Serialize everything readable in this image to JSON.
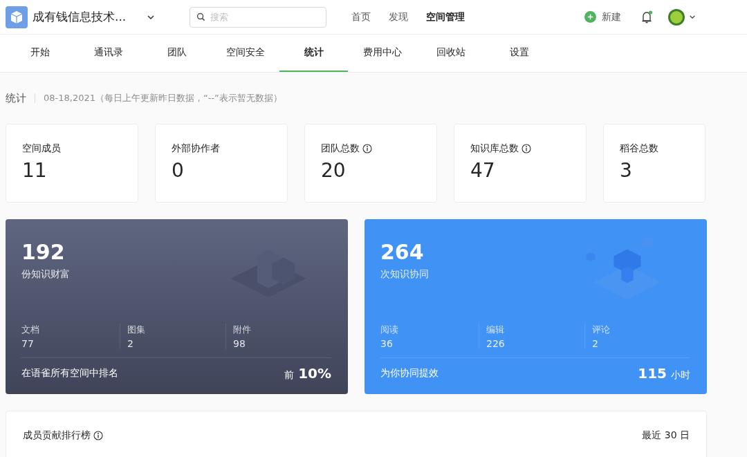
{
  "header": {
    "space_name": "成有钱信息技术...",
    "search": {
      "placeholder": "搜索"
    },
    "nav": [
      {
        "label": "首页",
        "selected": false
      },
      {
        "label": "发现",
        "selected": false
      },
      {
        "label": "空间管理",
        "selected": true
      }
    ],
    "new_button": "新建",
    "notifications": {
      "unread": true
    }
  },
  "tabs": [
    {
      "label": "开始",
      "selected": false
    },
    {
      "label": "通讯录",
      "selected": false
    },
    {
      "label": "团队",
      "selected": false
    },
    {
      "label": "空间安全",
      "selected": false
    },
    {
      "label": "统计",
      "selected": true
    },
    {
      "label": "费用中心",
      "selected": false
    },
    {
      "label": "回收站",
      "selected": false
    },
    {
      "label": "设置",
      "selected": false
    }
  ],
  "page": {
    "title": "统计",
    "subtitle": "08-18,2021（每日上午更新昨日数据，“--”表示暂无数据）"
  },
  "stat_cards": [
    {
      "label": "空间成员",
      "value": "11",
      "info": false
    },
    {
      "label": "外部协作者",
      "value": "0",
      "info": false
    },
    {
      "label": "团队总数",
      "value": "20",
      "info": true
    },
    {
      "label": "知识库总数",
      "value": "47",
      "info": true
    },
    {
      "label": "稻谷总数",
      "value": "3",
      "info": false
    }
  ],
  "summary_cards": [
    {
      "kind": "dark",
      "value": "192",
      "caption": "份知识财富",
      "metrics": [
        {
          "label": "文档",
          "value": "77"
        },
        {
          "label": "图集",
          "value": "2"
        },
        {
          "label": "附件",
          "value": "98"
        }
      ],
      "footer": {
        "label": "在语雀所有空间中排名",
        "prefix": "前",
        "value": "10%"
      }
    },
    {
      "kind": "blue",
      "value": "264",
      "caption": "次知识协同",
      "metrics": [
        {
          "label": "阅读",
          "value": "36"
        },
        {
          "label": "编辑",
          "value": "226"
        },
        {
          "label": "评论",
          "value": "2"
        }
      ],
      "footer": {
        "label": "为你协同提效",
        "value": "115",
        "suffix": "小时"
      }
    }
  ],
  "ranking": {
    "title": "成员贡献排行榜",
    "period": "最近 30 日"
  }
}
